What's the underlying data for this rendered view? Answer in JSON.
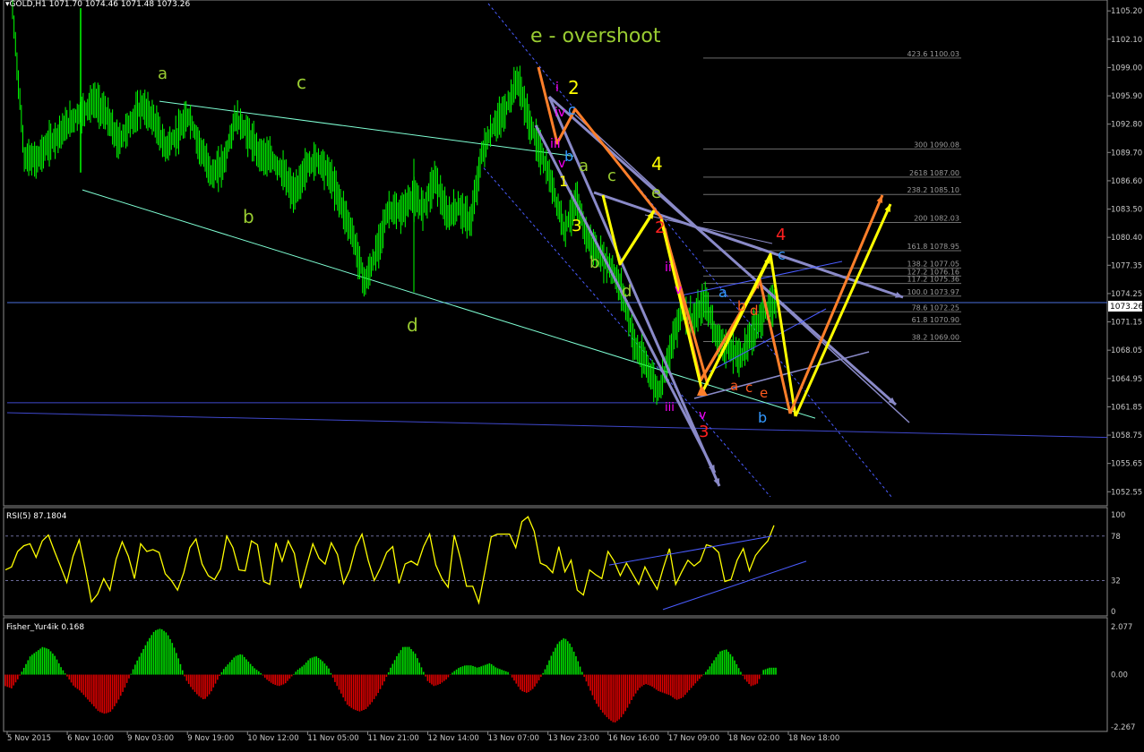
{
  "header": {
    "symbol_line": "▾GOLD,H1  1071.70 1074.46 1071.48 1073.26",
    "current_price_label": "1073.26"
  },
  "chart_data": [
    {
      "type": "candlestick",
      "name": "GOLD,H1",
      "ohlc": {
        "open": 1071.7,
        "high": 1074.46,
        "low": 1071.48,
        "close": 1073.26
      },
      "ylim": [
        1051.5,
        1106.0
      ],
      "y_ticks": [
        "1105.20",
        "1102.10",
        "1099.00",
        "1095.90",
        "1092.80",
        "1089.70",
        "1086.60",
        "1083.50",
        "1080.40",
        "1077.35",
        "1074.25",
        "1071.15",
        "1068.05",
        "1064.95",
        "1061.85",
        "1058.75",
        "1055.65",
        "1052.55"
      ],
      "x_ticks": [
        "5 Nov 2015",
        "6 Nov 10:00",
        "9 Nov 03:00",
        "9 Nov 19:00",
        "10 Nov 12:00",
        "11 Nov 05:00",
        "11 Nov 21:00",
        "12 Nov 14:00",
        "13 Nov 07:00",
        "13 Nov 23:00",
        "16 Nov 16:00",
        "17 Nov 09:00",
        "18 Nov 02:00",
        "18 Nov 18:00"
      ],
      "price_path": [
        1105.5,
        1089.2,
        1088.8,
        1090.5,
        1091.8,
        1093.2,
        1094.2,
        1095.4,
        1093.8,
        1090.8,
        1092.8,
        1094.8,
        1093.4,
        1090.2,
        1091.6,
        1093.8,
        1090.1,
        1087.2,
        1088.6,
        1093.5,
        1091.8,
        1089.6,
        1089.0,
        1087.6,
        1085.0,
        1088.1,
        1089.0,
        1087.3,
        1084.0,
        1080.5,
        1075.3,
        1078.8,
        1083.5,
        1083.0,
        1084.8,
        1083.6,
        1087.0,
        1082.6,
        1083.8,
        1082.0,
        1089.7,
        1092.6,
        1094.3,
        1097.8,
        1093.0,
        1089.7,
        1085.8,
        1081.3,
        1084.4,
        1080.2,
        1078.4,
        1077.0,
        1074.2,
        1068.5,
        1066.4,
        1063.4,
        1068.0,
        1072.6,
        1071.3,
        1073.5,
        1069.3,
        1068.2,
        1067.3,
        1069.9,
        1072.3,
        1073.3
      ],
      "fib_levels": [
        {
          "label": "423.6 1100.03",
          "price": 1100.03
        },
        {
          "label": "300 1090.08",
          "price": 1090.08
        },
        {
          "label": "2618 1087.00",
          "price": 1087.0
        },
        {
          "label": "238.2 1085.10",
          "price": 1085.1
        },
        {
          "label": "200 1082.03",
          "price": 1082.03
        },
        {
          "label": "161.8 1078.95",
          "price": 1078.95
        },
        {
          "label": "138.2 1077.05",
          "price": 1077.05
        },
        {
          "label": "127.2 1076.16",
          "price": 1076.16
        },
        {
          "label": "117.2 1075.36",
          "price": 1075.36
        },
        {
          "label": "100.0 1073.97",
          "price": 1073.97
        },
        {
          "label": "78.6 1072.25",
          "price": 1072.25
        },
        {
          "label": "61.8 1070.90",
          "price": 1070.9
        },
        {
          "label": "38.2 1069.00",
          "price": 1069.0
        }
      ],
      "annotations": [
        {
          "text": "e - overshoot",
          "color": "#9acd32"
        },
        {
          "text": "a",
          "color": "#9acd32"
        },
        {
          "text": "c",
          "color": "#9acd32"
        },
        {
          "text": "b",
          "color": "#9acd32"
        },
        {
          "text": "d",
          "color": "#9acd32"
        },
        {
          "text": "2",
          "color": "#ffff00"
        },
        {
          "text": "4",
          "color": "#ffff00"
        },
        {
          "text": "3",
          "color": "#ffff00"
        },
        {
          "text": "1",
          "color": "#ffff00"
        },
        {
          "text": "i",
          "color": "#ff00ff"
        },
        {
          "text": "iv",
          "color": "#ff00ff"
        },
        {
          "text": "iii",
          "color": "#ff00ff"
        },
        {
          "text": "v",
          "color": "#ff00ff"
        },
        {
          "text": "ii",
          "color": "#ff00ff"
        },
        {
          "text": "c",
          "color": "#3399ff"
        },
        {
          "text": "b",
          "color": "#3399ff"
        },
        {
          "text": "a",
          "color": "#3399ff"
        },
        {
          "text": "a",
          "color": "#9acd32"
        },
        {
          "text": "c",
          "color": "#9acd32"
        },
        {
          "text": "e",
          "color": "#9acd32"
        },
        {
          "text": "b",
          "color": "#9acd32"
        },
        {
          "text": "d",
          "color": "#9acd32"
        },
        {
          "text": "2",
          "color": "#ff2020"
        },
        {
          "text": "4",
          "color": "#ff2020"
        },
        {
          "text": "3",
          "color": "#ff2020"
        },
        {
          "text": "a",
          "color": "#ff5a1e"
        },
        {
          "text": "c",
          "color": "#ff5a1e"
        },
        {
          "text": "e",
          "color": "#ff5a1e"
        },
        {
          "text": "b",
          "color": "#ff5a1e"
        },
        {
          "text": "d",
          "color": "#ff5a1e"
        }
      ],
      "colors": {
        "candles": "#00ff00",
        "grid_blue": "#3f48cc",
        "trend_cyan": "#7fffd4",
        "projection_gray": "#8a8ac8",
        "yellow": "#ffff00",
        "orange": "#ff7f2a"
      }
    },
    {
      "type": "line",
      "name": "RSI(5) 87.1804",
      "ylim": [
        0,
        100
      ],
      "y_ticks": [
        "100",
        "78",
        "32",
        "0"
      ],
      "levels": [
        78,
        32
      ],
      "values": [
        43,
        46,
        62,
        68,
        70,
        56,
        73,
        79,
        62,
        46,
        30,
        57,
        74,
        44,
        10,
        18,
        34,
        22,
        54,
        72,
        57,
        34,
        70,
        62,
        64,
        61,
        39,
        32,
        22,
        40,
        66,
        75,
        49,
        37,
        33,
        44,
        78,
        66,
        43,
        42,
        73,
        69,
        31,
        28,
        71,
        52,
        73,
        60,
        24,
        47,
        70,
        55,
        49,
        71,
        59,
        29,
        43,
        67,
        80,
        53,
        32,
        45,
        61,
        67,
        29,
        49,
        52,
        48,
        67,
        80,
        48,
        34,
        25,
        79,
        55,
        26,
        26,
        9,
        42,
        77,
        80,
        80,
        80,
        66,
        93,
        98,
        83,
        50,
        47,
        40,
        67,
        41,
        53,
        22,
        17,
        43,
        38,
        34,
        62,
        52,
        37,
        50,
        39,
        28,
        46,
        34,
        23,
        45,
        65,
        28,
        41,
        53,
        47,
        52,
        69,
        67,
        61,
        31,
        33,
        53,
        65,
        42,
        58,
        66,
        73,
        89
      ],
      "color": "#ffff00"
    },
    {
      "type": "bar",
      "name": "Fisher_Yur4ik 0.168",
      "ylim": [
        -2.267,
        2.077
      ],
      "y_ticks": [
        "2.077",
        "0.00",
        "-2.267"
      ],
      "values": [
        -0.5,
        -0.6,
        -0.2,
        0.3,
        0.8,
        1.0,
        1.2,
        1.1,
        0.8,
        0.3,
        -0.1,
        -0.5,
        -0.7,
        -1.0,
        -1.3,
        -1.6,
        -1.7,
        -1.6,
        -1.2,
        -0.7,
        -0.1,
        0.5,
        1.0,
        1.5,
        1.9,
        2.0,
        1.8,
        1.3,
        0.6,
        -0.2,
        -0.6,
        -0.9,
        -1.1,
        -0.8,
        -0.3,
        0.2,
        0.5,
        0.8,
        0.9,
        0.6,
        0.3,
        0.1,
        -0.2,
        -0.4,
        -0.5,
        -0.4,
        -0.1,
        0.2,
        0.4,
        0.7,
        0.8,
        0.6,
        0.3,
        -0.3,
        -0.8,
        -1.3,
        -1.5,
        -1.6,
        -1.5,
        -1.2,
        -0.8,
        -0.3,
        0.3,
        0.8,
        1.2,
        1.2,
        0.9,
        0.3,
        -0.3,
        -0.5,
        -0.4,
        -0.2,
        0.1,
        0.3,
        0.4,
        0.4,
        0.3,
        0.4,
        0.5,
        0.3,
        0.2,
        0.1,
        -0.3,
        -0.7,
        -0.8,
        -0.6,
        -0.2,
        0.3,
        0.9,
        1.4,
        1.6,
        1.3,
        0.7,
        0.0,
        -0.6,
        -1.2,
        -1.6,
        -1.9,
        -2.1,
        -1.9,
        -1.5,
        -1.0,
        -0.6,
        -0.4,
        -0.5,
        -0.7,
        -0.8,
        -0.9,
        -1.1,
        -1.0,
        -0.7,
        -0.4,
        -0.1,
        0.2,
        0.6,
        1.0,
        1.1,
        0.8,
        0.3,
        -0.2,
        -0.5,
        -0.4,
        0.2,
        0.3,
        0.3
      ],
      "colors": {
        "positive": "#00dd00",
        "negative": "#dd0000"
      }
    }
  ]
}
